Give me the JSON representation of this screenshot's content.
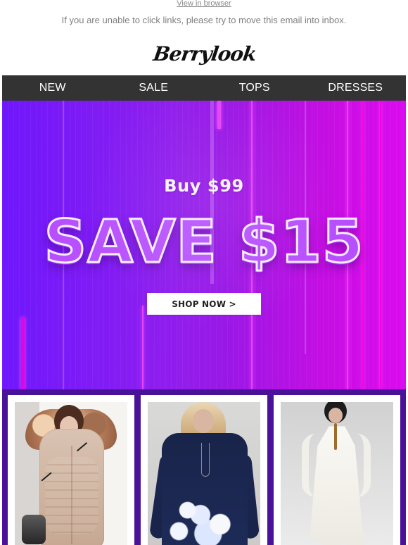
{
  "header": {
    "view_in_browser": "View in browser",
    "notice": "If you are unable to click links, please try to move this email into inbox.",
    "logo": "Berrylook"
  },
  "nav": {
    "items": [
      {
        "label": "NEW"
      },
      {
        "label": "SALE"
      },
      {
        "label": "TOPS"
      },
      {
        "label": "DRESSES"
      }
    ]
  },
  "hero": {
    "buy_text": "Buy $99",
    "save_text": "SAVE $15",
    "cta_label": "SHOP NOW >",
    "colors": {
      "accent_purple": "#7b1dff",
      "accent_magenta": "#d414ff",
      "button_bg": "#ffffff"
    }
  },
  "products": {
    "items": [
      {
        "icon": "beige-puffer-coat"
      },
      {
        "icon": "navy-floral-tunic"
      },
      {
        "icon": "white-layered-dress"
      }
    ],
    "section_bg": "#4a1299"
  }
}
